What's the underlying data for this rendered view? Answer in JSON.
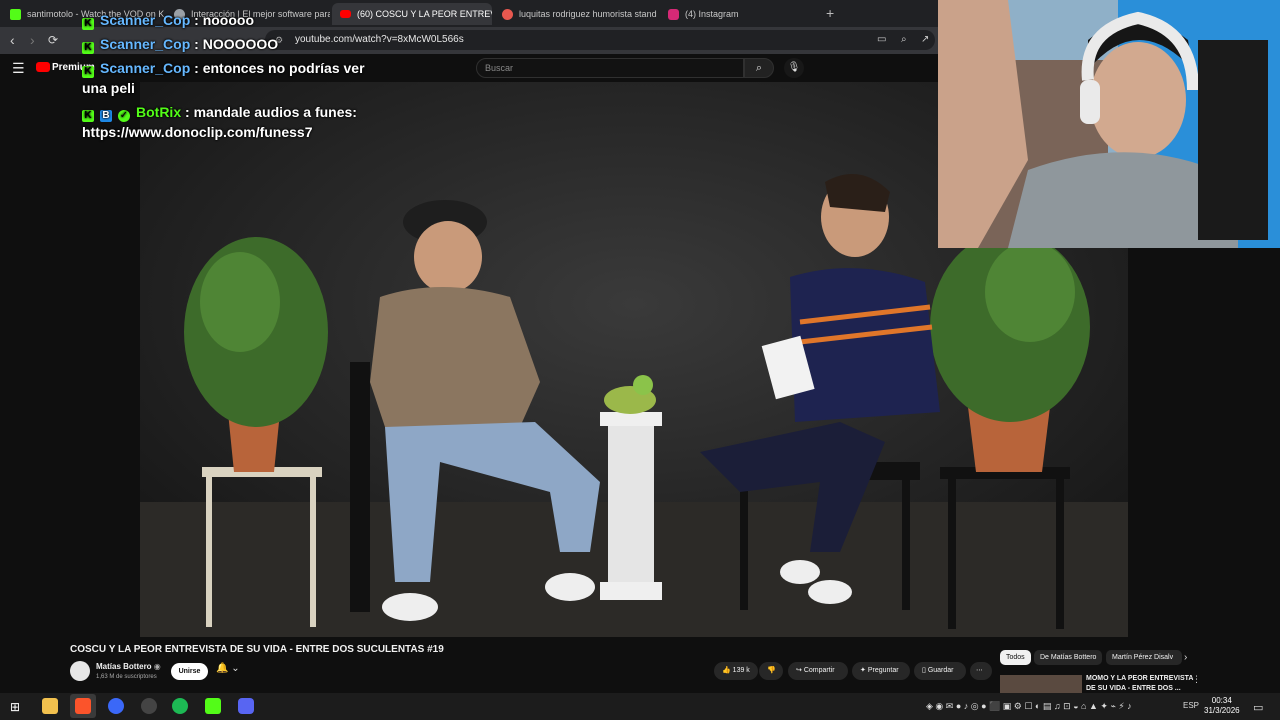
{
  "browser": {
    "tabs": [
      {
        "label": "santimotolo - Watch the VOD on Kick",
        "favicon_color": "#53fc18"
      },
      {
        "label": "Interacción | El mejor software para p",
        "favicon_color": "#9aa0a6"
      },
      {
        "label": "(60) COSCU Y LA PEOR ENTREVI",
        "favicon_color": "#ff0000",
        "active": true
      },
      {
        "label": "luquitas rodriguez humorista stand u",
        "favicon_color": "#e8584f"
      },
      {
        "label": "(4) Instagram",
        "favicon_color": "#d62976"
      }
    ],
    "url": "youtube.com/watch?v=8xMcW0L566s"
  },
  "youtube": {
    "logo_text": "Premium",
    "search_placeholder": "Buscar",
    "video_title": "COSCU Y LA PEOR ENTREVISTA DE SU VIDA - ENTRE DOS SUCULENTAS #19",
    "channel_name": "Matías Bottero",
    "subscribers": "1,63 M de suscriptores",
    "join_label": "Unirse",
    "likes": "139 k",
    "share_label": "Compartir",
    "ask_label": "Preguntar",
    "save_label": "Guardar",
    "chips": [
      "Todos",
      "De Matías Bottero",
      "Martín Pérez Disalv"
    ],
    "recommended_title": "MOMO Y LA PEOR ENTREVISTA DE SU VIDA - ENTRE DOS ..."
  },
  "chat": [
    {
      "user": "Scanner_Cop",
      "message": "nooooo"
    },
    {
      "user": "Scanner_Cop",
      "message": "NOOOOOO"
    },
    {
      "user": "Scanner_Cop",
      "message": "entonces no podrías ver"
    },
    {
      "continuation": "una peli"
    },
    {
      "user": "BotRix",
      "message": "mandale audios a funes:"
    },
    {
      "continuation": "https://www.donoclip.com/funess7"
    }
  ],
  "taskbar": {
    "language": "ESP",
    "time": "00:34",
    "date": "31/3/2026"
  }
}
